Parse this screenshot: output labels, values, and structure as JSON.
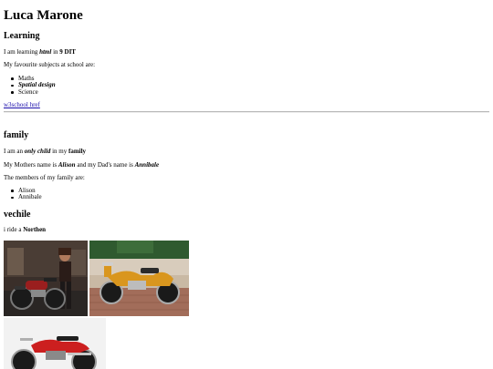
{
  "title": "Luca Marone",
  "learning": {
    "heading": "Learning",
    "line1_pre": "I am learning ",
    "line1_em": "html",
    "line1_mid": " in ",
    "line1_strong": "9 DIT",
    "line2": "My favourite subjects at school are:",
    "subjects": [
      "Maths",
      "Spatial design",
      "Science"
    ],
    "link_text": "w3school href"
  },
  "family": {
    "heading": "family",
    "line1_pre": "I am an ",
    "line1_em": "only child",
    "line1_mid": " in my ",
    "line1_strong": "family",
    "line2_pre": "My Mothers name is ",
    "line2_mom": "Alison",
    "line2_mid": " and my Dad's name is ",
    "line2_dad": "Annibale",
    "line3": "The members of my family are:",
    "members": [
      "Alison",
      "Annibale"
    ]
  },
  "vehicle": {
    "heading": "vechile",
    "line_pre": "i ride a ",
    "line_strong": "Northen"
  },
  "colors": {
    "link": "#1a0dab",
    "rule": "#b8b8b8"
  }
}
